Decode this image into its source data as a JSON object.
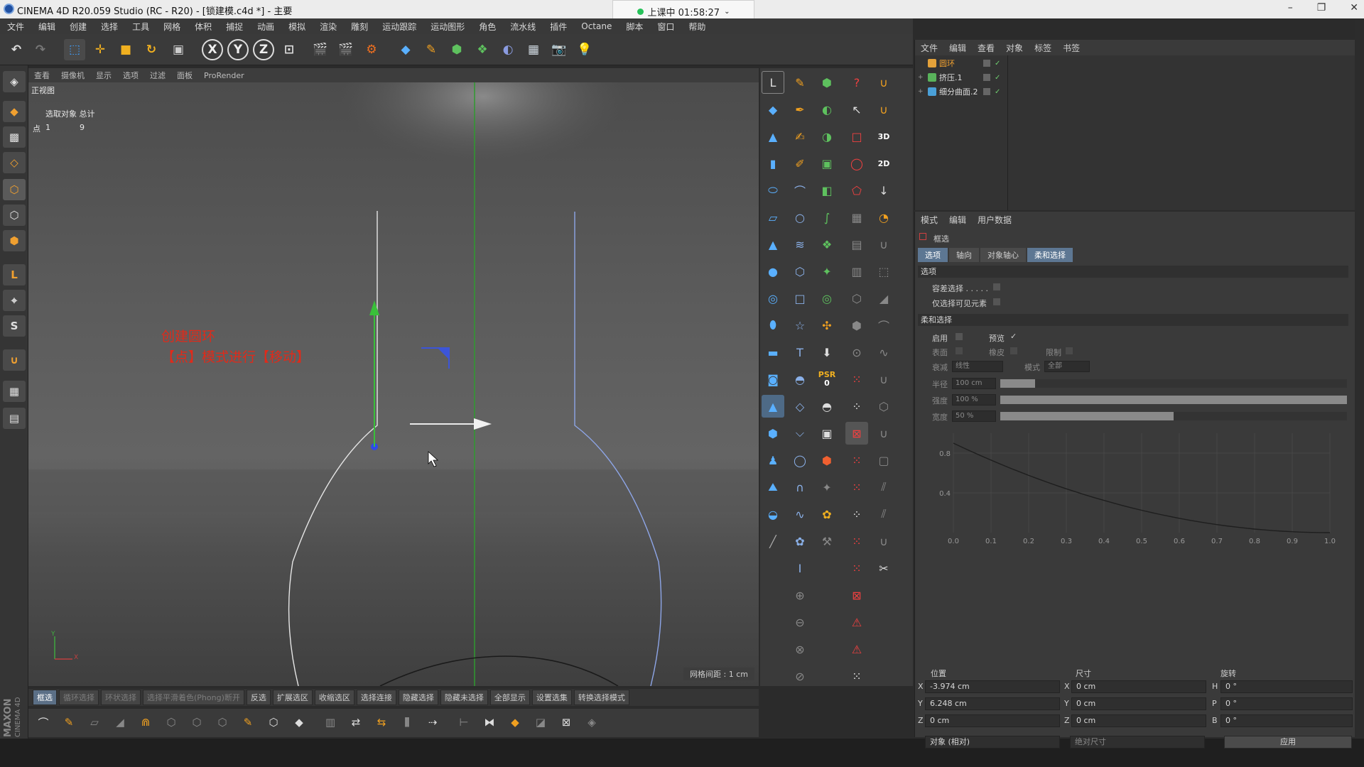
{
  "window": {
    "title": "CINEMA 4D R20.059 Studio (RC - R20) - [锁建模.c4d *] - 主要",
    "timer": "上课中 01:58:27",
    "min": "–",
    "max": "❐",
    "close": "✕"
  },
  "menu": [
    "文件",
    "编辑",
    "创建",
    "选择",
    "工具",
    "网格",
    "体积",
    "捕捉",
    "动画",
    "模拟",
    "渲染",
    "雕刻",
    "运动跟踪",
    "运动图形",
    "角色",
    "流水线",
    "插件",
    "Octane",
    "脚本",
    "窗口",
    "帮助"
  ],
  "toolbar": {
    "x": "X",
    "y": "Y",
    "z": "Z"
  },
  "viewport": {
    "menu": [
      "查看",
      "摄像机",
      "显示",
      "选项",
      "过滤",
      "面板",
      "ProRender"
    ],
    "name": "正视图",
    "info_header": "选取对象 总计",
    "info_label": "点",
    "info_selected": "1",
    "info_total": "9",
    "grid_note": "网格间距 : 1 cm",
    "annotation_line1": "创建圆环",
    "annotation_line2": "【点】模式进行【移动】",
    "axis_y": "Y",
    "axis_x": "X"
  },
  "psr": {
    "label": "PSR",
    "value": "0"
  },
  "selection_bar": [
    {
      "label": "框选",
      "state": "on"
    },
    {
      "label": "循环选择",
      "state": "dim"
    },
    {
      "label": "环状选择",
      "state": "dim"
    },
    {
      "label": "选择平滑着色(Phong)断开",
      "state": "dim"
    },
    {
      "label": "反选",
      "state": ""
    },
    {
      "label": "扩展选区",
      "state": ""
    },
    {
      "label": "收缩选区",
      "state": ""
    },
    {
      "label": "选择连接",
      "state": ""
    },
    {
      "label": "隐藏选择",
      "state": ""
    },
    {
      "label": "隐藏未选择",
      "state": ""
    },
    {
      "label": "全部显示",
      "state": ""
    },
    {
      "label": "设置选集",
      "state": ""
    },
    {
      "label": "转换选择模式",
      "state": ""
    }
  ],
  "brand": {
    "maxon": "MAXON",
    "cinema": "CINEMA 4D"
  },
  "object_manager": {
    "menu": [
      "文件",
      "编辑",
      "查看",
      "对象",
      "标签",
      "书签"
    ],
    "objects": [
      {
        "name": "圆环",
        "color": "#e3a13a"
      },
      {
        "name": "挤压.1",
        "color": "#59b35b"
      },
      {
        "name": "细分曲面.2",
        "color": "#4aa0d8"
      }
    ]
  },
  "attributes": {
    "menu": [
      "模式",
      "编辑",
      "用户数据"
    ],
    "title": "框选",
    "tabs": [
      {
        "label": "选项",
        "state": "on"
      },
      {
        "label": "轴向",
        "state": ""
      },
      {
        "label": "对象轴心",
        "state": ""
      },
      {
        "label": "柔和选择",
        "state": "on"
      }
    ],
    "section_options": "选项",
    "tolerant": "容差选择 . . . . .",
    "visible_only": "仅选择可见元素",
    "section_soft": "柔和选择",
    "enable": "启用",
    "preview": "预览",
    "preview_check": "✓",
    "surface": "表面",
    "rubber": "橡皮",
    "restrict": "限制",
    "falloff_label": "衰减",
    "falloff_value": "线性",
    "mode_label": "模式",
    "mode_value": "全部",
    "radius_label": "半径",
    "radius_value": "100 cm",
    "strength_label": "强度",
    "strength_value": "100 %",
    "strength_fraction": 1.0,
    "width_label": "宽度",
    "width_value": "50 %",
    "width_fraction": 0.5,
    "radius_fraction": 0.1
  },
  "curve": {
    "y_ticks": [
      "0.8",
      "0.4"
    ],
    "x_ticks": [
      "0.0",
      "0.1",
      "0.2",
      "0.3",
      "0.4",
      "0.5",
      "0.6",
      "0.7",
      "0.8",
      "0.9",
      "1.0"
    ]
  },
  "coordinates": {
    "headers": {
      "position": "位置",
      "size": "尺寸",
      "rotation": "旋转"
    },
    "rows": [
      {
        "axis": "X",
        "pos": "-3.974 cm",
        "size_axis": "X",
        "size": "0 cm",
        "rot_axis": "H",
        "rot": "0 °"
      },
      {
        "axis": "Y",
        "pos": "6.248 cm",
        "size_axis": "Y",
        "size": "0 cm",
        "rot_axis": "P",
        "rot": "0 °"
      },
      {
        "axis": "Z",
        "pos": "0 cm",
        "size_axis": "Z",
        "size": "0 cm",
        "rot_axis": "B",
        "rot": "0 °"
      }
    ],
    "mode": "对象 (相对)",
    "size_mode": "绝对尺寸",
    "apply": "应用"
  }
}
